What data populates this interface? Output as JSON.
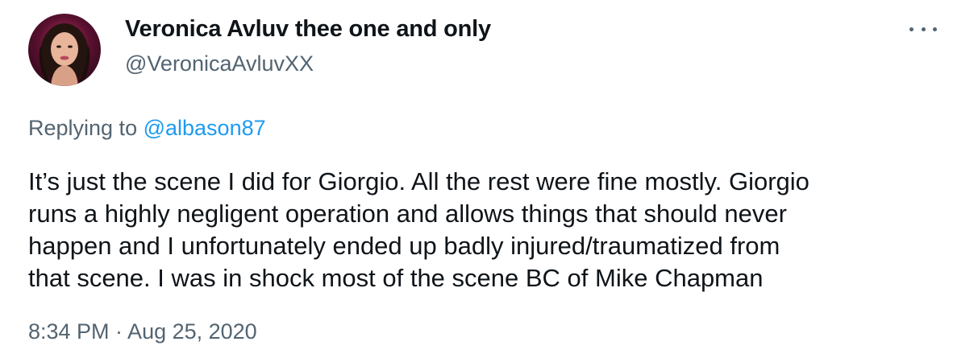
{
  "author": {
    "display_name": "Veronica Avluv thee one and only",
    "handle": "@VeronicaAvluvXX",
    "avatar_icon": "profile-photo-avatar"
  },
  "menu": {
    "icon": "more-horizontal-icon"
  },
  "reply_context": {
    "prefix": "Replying to ",
    "mention": "@albason87"
  },
  "tweet": {
    "lines": [
      "It’s just the scene I did for Giorgio. All the rest were fine mostly. Giorgio",
      "runs a highly negligent operation and allows things that should never",
      "happen and I unfortunately ended up badly injured/traumatized from",
      "that scene. I was in shock most of the scene BC of Mike Chapman"
    ],
    "timestamp": "8:34 PM · Aug 25, 2020"
  },
  "colors": {
    "text_primary": "#0f1419",
    "text_secondary": "#536471",
    "link": "#1d9bf0",
    "background": "#ffffff"
  }
}
